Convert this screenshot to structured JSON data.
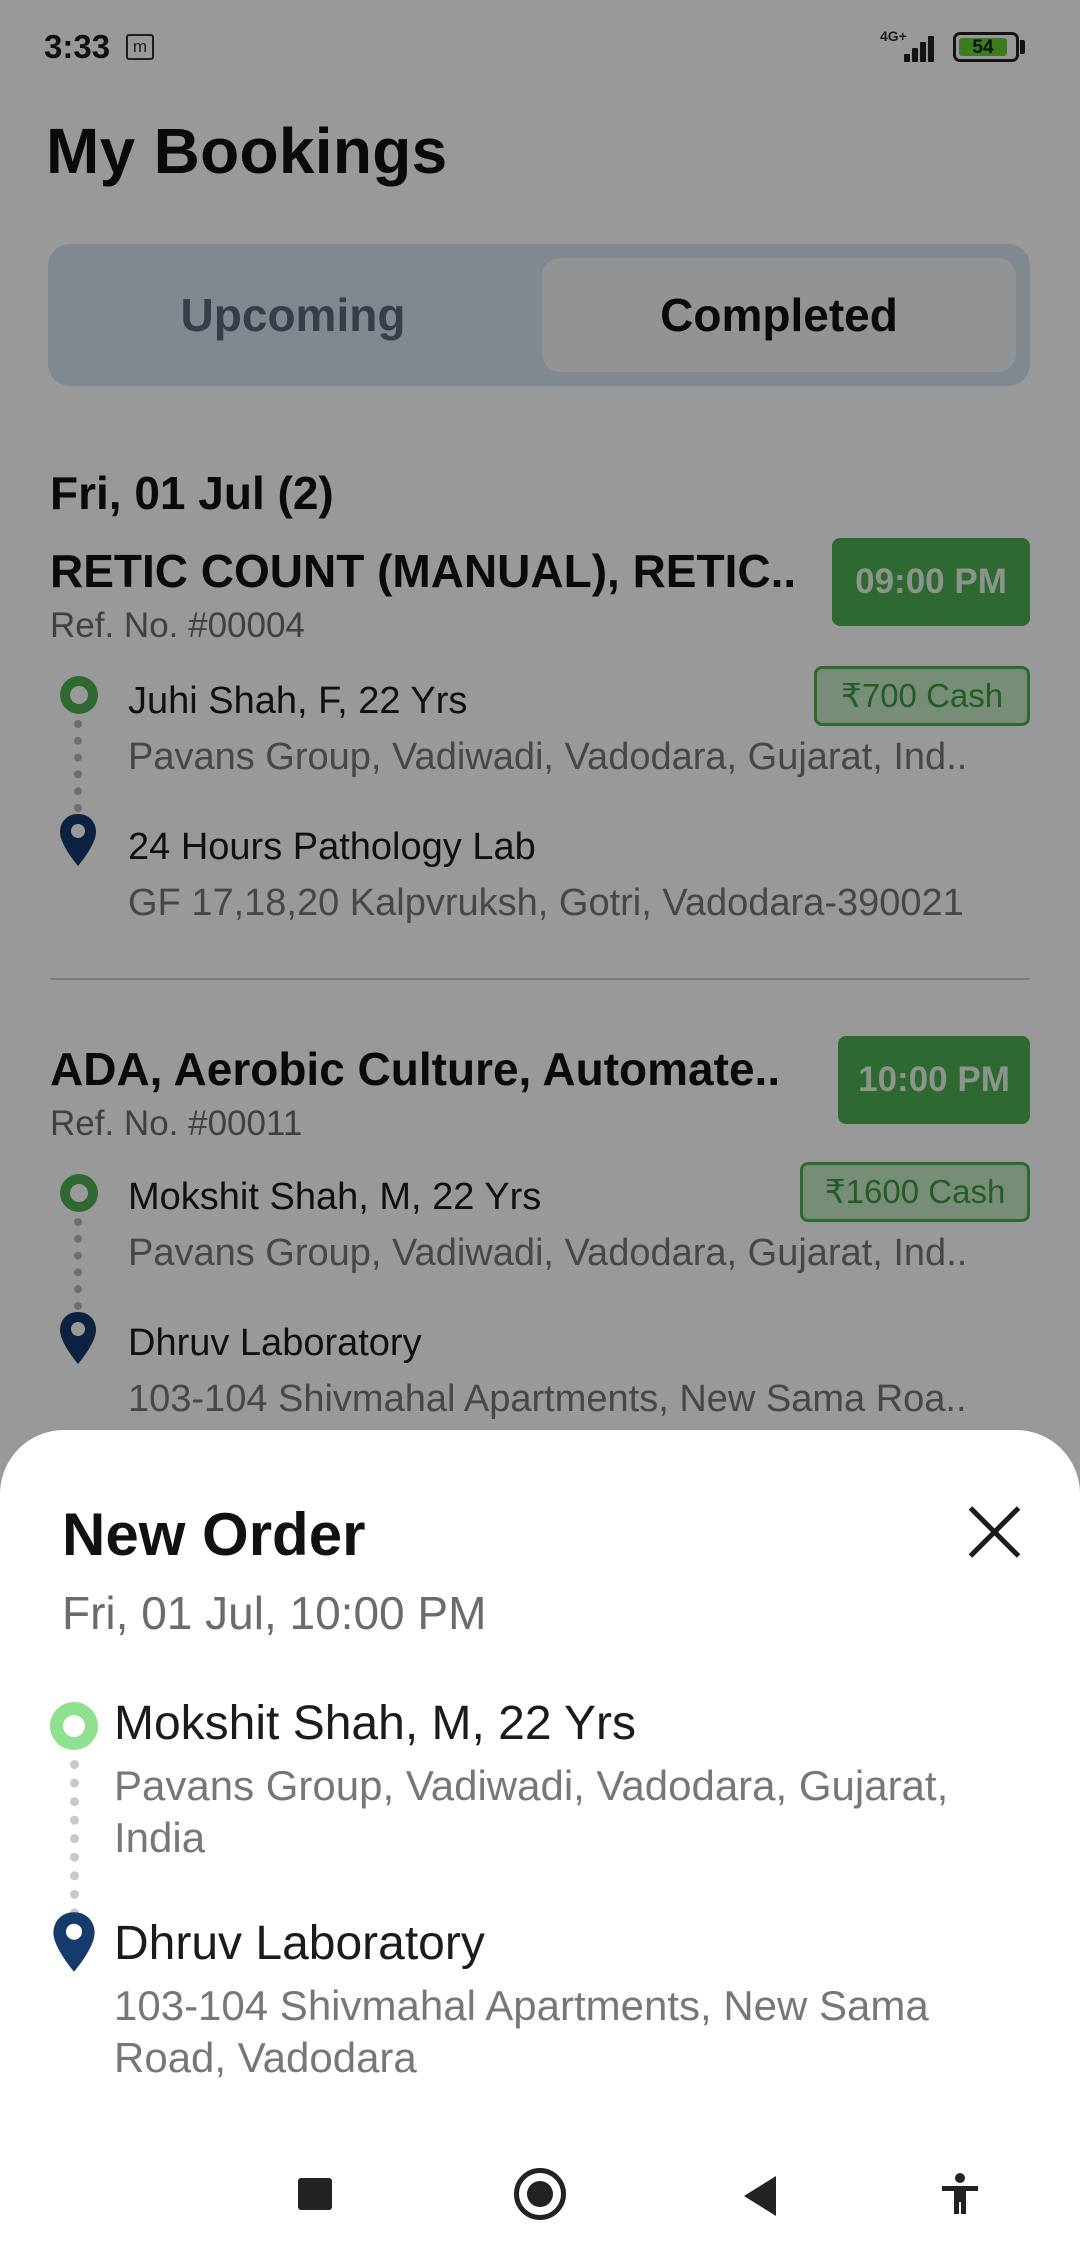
{
  "status_bar": {
    "time": "3:33",
    "notification_icon": "m",
    "network": "4G+",
    "battery": "54",
    "battery_color": "#6acf37"
  },
  "page": {
    "title": "My Bookings"
  },
  "tabs": [
    {
      "label": "Upcoming",
      "active": false
    },
    {
      "label": "Completed",
      "active": true
    }
  ],
  "list": {
    "date_heading": "Fri, 01 Jul (2)",
    "bookings": [
      {
        "title": "RETIC COUNT (MANUAL), RETIC..",
        "ref": "Ref. No. #00004",
        "time": "09:00 PM",
        "amount": "₹700 Cash",
        "patient": "Juhi Shah, F, 22 Yrs",
        "patient_address": "Pavans Group, Vadiwadi, Vadodara, Gujarat, Ind..",
        "lab": "24 Hours Pathology Lab",
        "lab_address": "GF 17,18,20 Kalpvruksh, Gotri, Vadodara-390021"
      },
      {
        "title": "ADA, Aerobic Culture, Automate..",
        "ref": "Ref. No. #00011",
        "time": "10:00 PM",
        "amount": "₹1600 Cash",
        "patient": "Mokshit Shah, M, 22 Yrs",
        "patient_address": "Pavans Group, Vadiwadi, Vadodara, Gujarat, Ind..",
        "lab": "Dhruv Laboratory",
        "lab_address": "103-104 Shivmahal Apartments, New Sama Roa.."
      }
    ]
  },
  "sheet": {
    "title": "New Order",
    "subtitle": "Fri, 01 Jul, 10:00 PM",
    "patient": "Mokshit Shah, M, 22 Yrs",
    "patient_address": "Pavans Group, Vadiwadi, Vadodara, Gujarat, India",
    "lab": "Dhruv Laboratory",
    "lab_address": "103-104 Shivmahal Apartments, New Sama Road, Vadodara"
  },
  "colors": {
    "accent_green": "#4caf50",
    "pin_navy": "#163a6b",
    "tab_bg": "#d6e3f0"
  },
  "icons": {
    "close": "close-icon",
    "pickup": "circle-marker-icon",
    "drop": "location-pin-icon",
    "nav": [
      "recents-square-icon",
      "home-circle-icon",
      "back-triangle-icon",
      "accessibility-icon"
    ]
  }
}
